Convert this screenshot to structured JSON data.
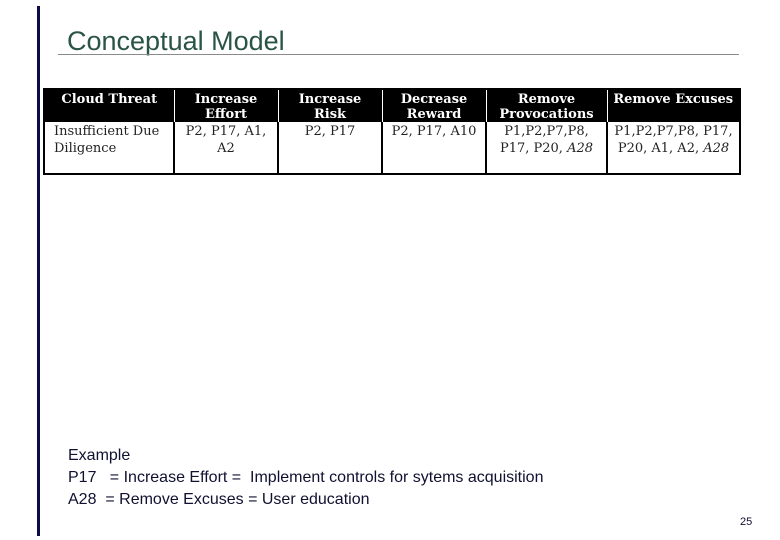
{
  "slide": {
    "title": "Conceptual Model",
    "page_number": "25"
  },
  "table": {
    "headers": [
      "Cloud Threat",
      "Increase Effort",
      "Increase Risk",
      "Decrease Reward",
      "Remove Provocations",
      "Remove Excuses"
    ],
    "rows": [
      {
        "cloud_threat": "Insufficient Due Diligence",
        "increase_effort": "P2, P17, A1, A2",
        "increase_risk": "P2, P17",
        "decrease_reward": "P2, P17, A10",
        "remove_provocations_plain": "P1,P2,P7,P8, P17, P20, ",
        "remove_provocations_italic": "A28",
        "remove_excuses_plain": "P1,P2,P7,P8, P17, P20, A1, A2, ",
        "remove_excuses_italic": "A28"
      }
    ]
  },
  "example": {
    "heading": "Example",
    "lines": [
      "P17   = Increase Effort =  Implement controls for sytems acquisition",
      "A28  = Remove Excuses = User education"
    ]
  }
}
